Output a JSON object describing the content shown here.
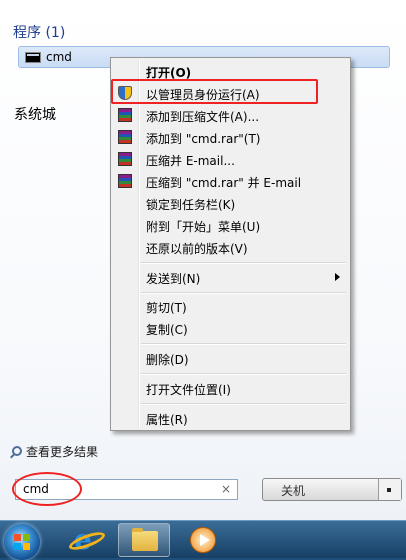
{
  "start_menu": {
    "results_header": "程序 (1)",
    "program_result": "cmd",
    "section_label": "系统城",
    "see_more": "查看更多结果",
    "search": {
      "value": "cmd",
      "clear": "×"
    },
    "shutdown": {
      "label": "关机"
    }
  },
  "context_menu": {
    "items": [
      {
        "label": "打开(O)",
        "bold": true,
        "icon": ""
      },
      {
        "label": "以管理员身份运行(A)",
        "icon": "uac-shield-icon"
      },
      {
        "label": "添加到压缩文件(A)...",
        "icon": "winrar-icon"
      },
      {
        "label": "添加到 \"cmd.rar\"(T)",
        "icon": "winrar-icon"
      },
      {
        "label": "压缩并 E-mail...",
        "icon": "winrar-icon"
      },
      {
        "label": "压缩到 \"cmd.rar\" 并 E-mail",
        "icon": "winrar-icon"
      },
      {
        "label": "锁定到任务栏(K)"
      },
      {
        "label": "附到「开始」菜单(U)"
      },
      {
        "label": "还原以前的版本(V)"
      },
      {
        "label": "发送到(N)",
        "submenu": true
      },
      {
        "label": "剪切(T)"
      },
      {
        "label": "复制(C)"
      },
      {
        "label": "删除(D)"
      },
      {
        "label": "打开文件位置(I)"
      },
      {
        "label": "属性(R)"
      }
    ]
  },
  "taskbar": {
    "icons": [
      "start-orb-icon",
      "internet-explorer-icon",
      "windows-explorer-icon",
      "media-player-icon"
    ]
  }
}
